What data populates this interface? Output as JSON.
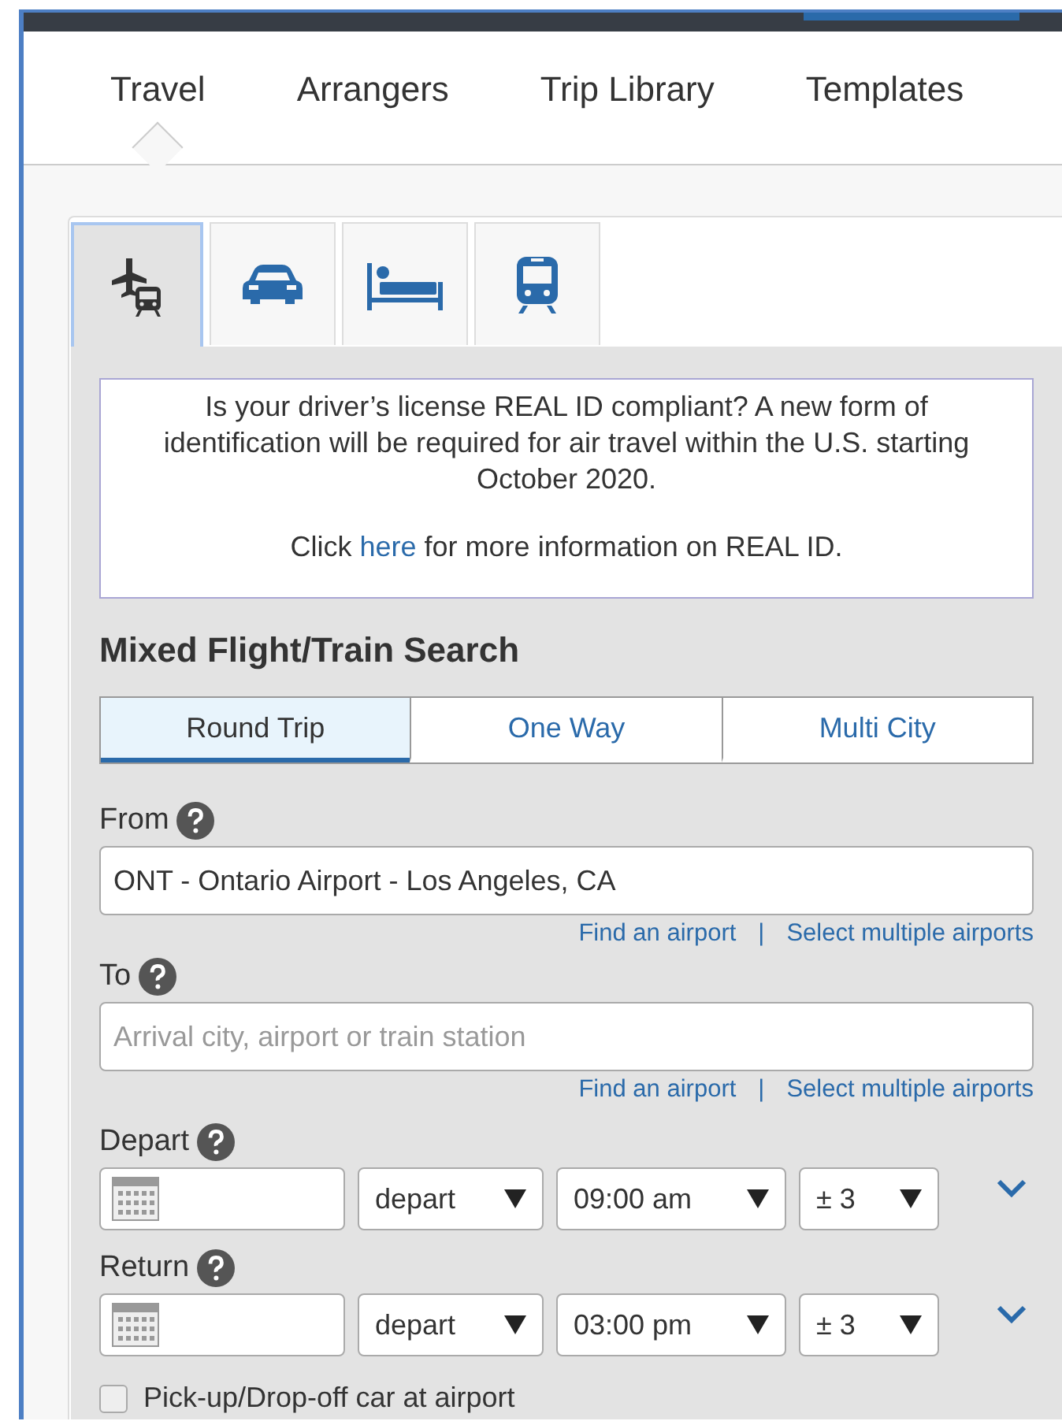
{
  "nav_tabs": [
    {
      "label": "Travel",
      "selected": true
    },
    {
      "label": "Arrangers",
      "selected": false
    },
    {
      "label": "Trip Library",
      "selected": false
    },
    {
      "label": "Templates",
      "selected": false
    }
  ],
  "mode_tabs": [
    {
      "kind": "flight-train",
      "selected": true
    },
    {
      "kind": "car",
      "selected": false
    },
    {
      "kind": "hotel",
      "selected": false
    },
    {
      "kind": "train",
      "selected": false
    }
  ],
  "notice": {
    "text": "Is your driver’s license REAL ID compliant? A new form of identification will be required for air travel within the U.S. starting October 2020.",
    "link_before": "Click",
    "link": "here",
    "link_after": "for more information on REAL ID."
  },
  "title": "Mixed Flight/Train Search",
  "trip_types": [
    {
      "label": "Round Trip",
      "selected": true
    },
    {
      "label": "One Way",
      "selected": false
    },
    {
      "label": "Multi City",
      "selected": false
    }
  ],
  "locations": [
    {
      "label": "From",
      "value": "ONT - Ontario Airport - Los Angeles, CA",
      "links": [
        "Find an airport",
        "|",
        "Select multiple airports"
      ]
    },
    {
      "label": "To",
      "placeholder": "Arrival city, airport or train station",
      "links": [
        "Find an airport",
        "|",
        "Select multiple airports"
      ]
    }
  ],
  "dates": [
    {
      "label": "Depart",
      "mode": "depart",
      "time": "09:00 am",
      "range": "± 3"
    },
    {
      "label": "Return",
      "mode": "depart",
      "time": "03:00 pm",
      "range": "± 3"
    }
  ],
  "car_option": {
    "label": "Pick-up/Drop-off car at airport",
    "checked": false
  }
}
